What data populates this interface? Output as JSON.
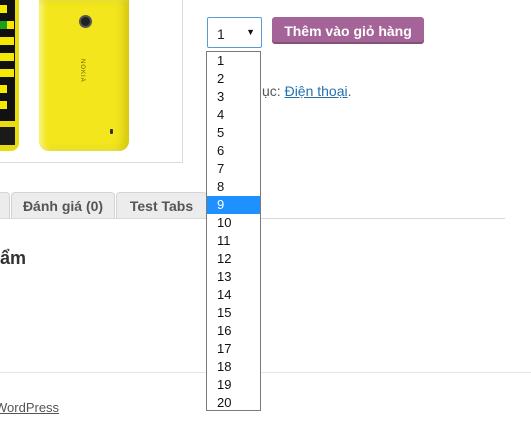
{
  "product": {
    "image_alt": "Nokia Lumia yellow phone",
    "brand_text": "NOKIA"
  },
  "cart": {
    "quantity_value": "1",
    "add_to_cart_label": "Thêm vào giỏ hàng",
    "quantity_options": [
      "1",
      "2",
      "3",
      "4",
      "5",
      "6",
      "7",
      "8",
      "9",
      "10",
      "11",
      "12",
      "13",
      "14",
      "15",
      "16",
      "17",
      "18",
      "19",
      "20"
    ],
    "highlighted_option": "9"
  },
  "meta": {
    "category_prefix": "ục: ",
    "category_link": "Điện thoại",
    "category_suffix": "."
  },
  "tabs": [
    {
      "label": ""
    },
    {
      "label": "Đánh giá (0)"
    },
    {
      "label": "Test Tabs"
    }
  ],
  "section": {
    "heading": "ẩm"
  },
  "footer": {
    "text": "WordPress"
  },
  "colors": {
    "button": "#a46497",
    "highlight": "#1e90ff",
    "phone": "#f3e61c"
  }
}
